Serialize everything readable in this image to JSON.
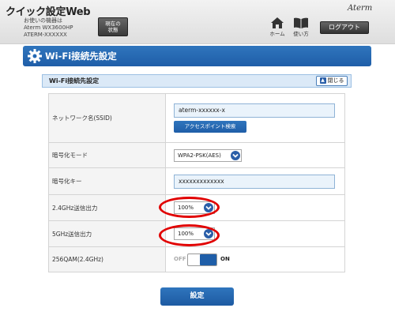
{
  "header": {
    "app_title": "クイック設定Web",
    "device_caption": "お使いの機器は",
    "device_model": "Aterm WX3600HP",
    "device_name": "ATERM-XXXXXX",
    "status_button_line1": "現在の",
    "status_button_line2": "状態",
    "brand": "Aterm",
    "home_label": "ホーム",
    "help_label": "使い方",
    "logout_label": "ログアウト"
  },
  "section": {
    "title": "Wi-Fi接続先設定",
    "icon": "gear-icon"
  },
  "panel": {
    "title": "Wi-Fi接続先設定",
    "collapse_label": "閉じる"
  },
  "fields": {
    "ssid": {
      "label": "ネットワーク名(SSID)",
      "value": "aterm-xxxxxx-x",
      "search_button": "アクセスポイント検索"
    },
    "encryption": {
      "label": "暗号化モード",
      "value": "WPA2-PSK(AES)"
    },
    "key": {
      "label": "暗号化キー",
      "value": "xxxxxxxxxxxxx"
    },
    "power_24": {
      "label": "2.4GHz送信出力",
      "value": "100%"
    },
    "power_5": {
      "label": "5GHz送信出力",
      "value": "100%"
    },
    "qam": {
      "label": "256QAM(2.4GHz)",
      "off_label": "OFF",
      "on_label": "ON",
      "state": "ON"
    }
  },
  "submit_label": "設定",
  "colors": {
    "accent": "#1f5ea8",
    "highlight": "#e10000",
    "panel_head": "#dbe9f7"
  }
}
